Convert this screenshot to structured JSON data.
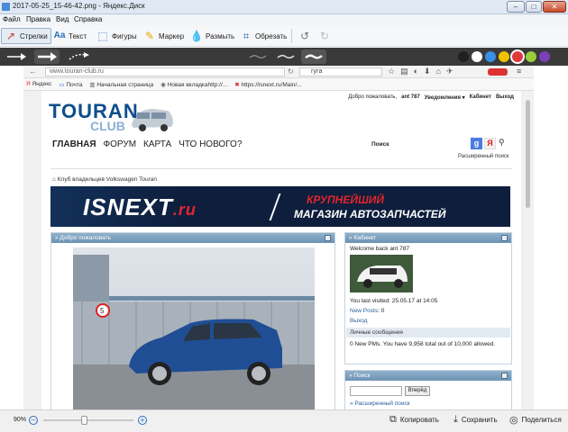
{
  "titlebar": {
    "title": "2017-05-25_15-46-42.png - Яндекс.Диск"
  },
  "menubar": {
    "items": [
      "Файл",
      "Правка",
      "Вид",
      "Справка"
    ]
  },
  "toolbar": {
    "tools": [
      {
        "label": "Стрелки",
        "icon": "arrow-tool-icon"
      },
      {
        "label": "Текст",
        "icon": "text-tool-icon"
      },
      {
        "label": "Фигуры",
        "icon": "shapes-tool-icon"
      },
      {
        "label": "Маркер",
        "icon": "marker-tool-icon"
      },
      {
        "label": "Размыть",
        "icon": "blur-tool-icon"
      },
      {
        "label": "Обрезать",
        "icon": "crop-tool-icon"
      }
    ]
  },
  "palette": {
    "colors": [
      "#202020",
      "#ffffff",
      "#3a8ee6",
      "#f2c200",
      "#e0393c",
      "#9bcf3a",
      "#7b3fb8"
    ]
  },
  "browser": {
    "url": "www.touran-club.ru",
    "search": "гуга",
    "bookmarks": [
      "Яндекс",
      "Почта",
      "Начальная страница",
      "Новая вкладкаhttp://...",
      "https://isnext.ru/Main/..."
    ]
  },
  "site": {
    "logo_top": "TOURAN",
    "logo_bottom": "CLUB",
    "userbar": {
      "welcome": "Добро пожаловать,",
      "user": "ant 787",
      "notifications": "Уведомления ▾",
      "cabinet": "Кабинет",
      "exit": "Выход"
    },
    "nav": [
      "ГЛАВНАЯ",
      "ФОРУМ",
      "КАРТА",
      "ЧТО НОВОГО?"
    ],
    "search_label": "Поиск",
    "adv_search": "Расширенный поиск",
    "breadcrumb": "Клуб владельцев Volkswagen Touran",
    "banner_brand": "ISNEXT",
    "banner_tld": ".ru",
    "banner_line1": "КРУПНЕЙШИЙ",
    "banner_line2": "МАГАЗИН АВТОЗАПЧАСТЕЙ",
    "welcome_box": {
      "title": "» Добро пожаловать"
    },
    "cabinet_box": {
      "title": "» Кабинет",
      "welcome_back": "Welcome back ant 787",
      "last_visited": "You last visited: 25.05.17 at 14:05",
      "new_posts_label": "New Posts",
      "new_posts_value": ": 0",
      "logout": "Выход",
      "pm_header": "Личные сообщения",
      "pm_text": "0 New PMs. You have 9,958 total out of 10,000 allowed."
    },
    "search_box": {
      "title": "» Поиск",
      "button": "Вперёд",
      "adv": "» Расширенный поиск"
    }
  },
  "bottombar": {
    "zoom": "90%",
    "zoom_level": 0.45,
    "copy": "Копировать",
    "save": "Сохранить",
    "share": "Поделиться"
  }
}
